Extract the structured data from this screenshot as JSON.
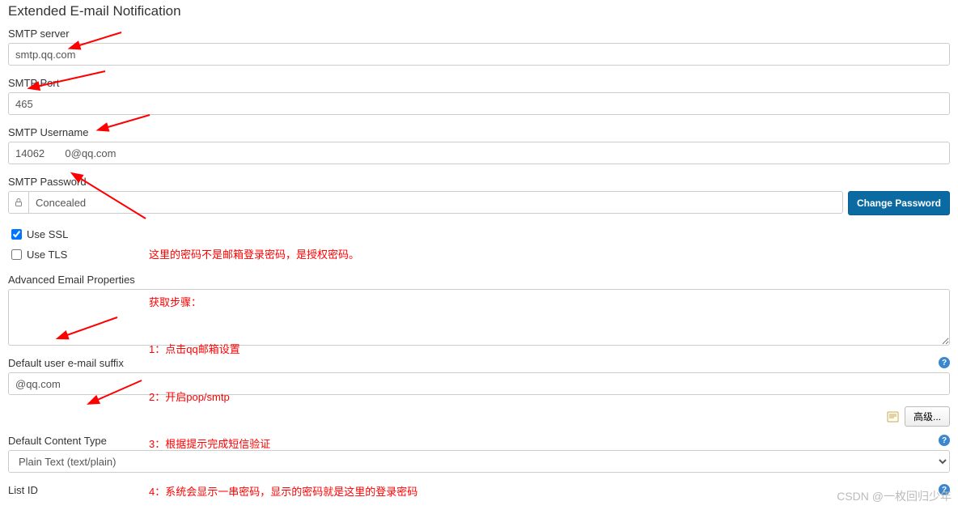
{
  "section_title": "Extended E-mail Notification",
  "smtp_server": {
    "label": "SMTP server",
    "value": "smtp.qq.com"
  },
  "smtp_port": {
    "label": "SMTP Port",
    "value": "465"
  },
  "smtp_user": {
    "label": "SMTP Username",
    "value": "14062       0@qq.com"
  },
  "smtp_pass": {
    "label": "SMTP Password",
    "concealed": "Concealed",
    "change_btn": "Change Password"
  },
  "use_ssl": {
    "label": "Use SSL",
    "checked": true
  },
  "use_tls": {
    "label": "Use TLS",
    "checked": false
  },
  "adv_props": {
    "label": "Advanced Email Properties",
    "value": ""
  },
  "suffix": {
    "label": "Default user e-mail suffix",
    "value": "@qq.com"
  },
  "content_type": {
    "label": "Default Content Type",
    "selected": "Plain Text (text/plain)"
  },
  "list_id": {
    "label": "List ID"
  },
  "advanced_btn": "高级...",
  "help_glyph": "?",
  "annotation": {
    "line1": "这里的密码不是邮箱登录密码，是授权密码。",
    "line2": "获取步骤：",
    "line3": "1：点击qq邮箱设置",
    "line4": "2：开启pop/smtp",
    "line5": "3：根据提示完成短信验证",
    "line6": "4：系统会显示一串密码，显示的密码就是这里的登录密码"
  },
  "watermark": "CSDN @一枚回归少年"
}
